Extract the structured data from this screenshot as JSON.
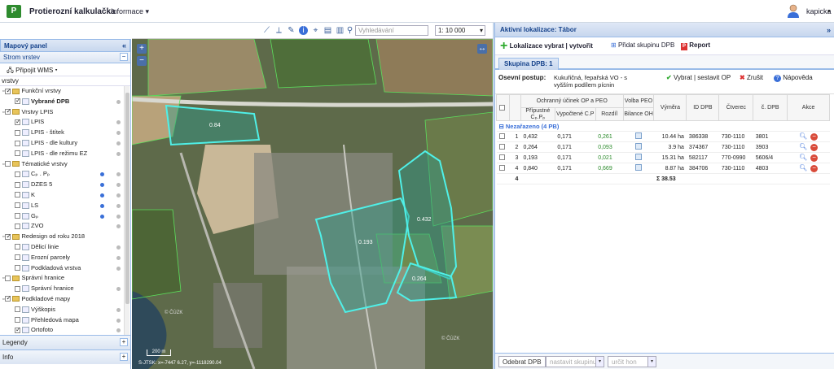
{
  "app": {
    "logo": "P",
    "title": "Protierozní kalkulačka",
    "info_menu": "Informace",
    "user": "kapicka"
  },
  "map_toolbar": {
    "search_placeholder": "Vyhledávání",
    "scale": "1: 10 000"
  },
  "map": {
    "scalebar": "200 m",
    "coords": "S-JTSK: x=-7447 6.27, y=-1118290.04",
    "watermark": "© ČÚZK",
    "labels": {
      "p1": "0.84",
      "p2": "0.193",
      "p3": "0.432",
      "p4": "0.264"
    }
  },
  "left_panel": {
    "title": "Mapový panel",
    "tree_title": "Strom vrstev",
    "wms_button": "Připojit WMS",
    "layers_label": "vrstvy",
    "tree": [
      {
        "label": "Funkční vrstvy",
        "level": 0,
        "type": "folder",
        "checked": true
      },
      {
        "label": "Vybrané DPB",
        "level": 1,
        "type": "layer",
        "checked": true,
        "bold": true,
        "dot": true
      },
      {
        "label": "Vrstvy LPIS",
        "level": 0,
        "type": "folder",
        "checked": true
      },
      {
        "label": "LPIS",
        "level": 1,
        "type": "layer",
        "checked": true,
        "dot": true
      },
      {
        "label": "LPIS - štítek",
        "level": 1,
        "type": "layer",
        "checked": false,
        "dot": true
      },
      {
        "label": "LPIS - dle kultury",
        "level": 1,
        "type": "layer",
        "checked": false,
        "dot": true
      },
      {
        "label": "LPIS - dle režimu EZ",
        "level": 1,
        "type": "layer",
        "checked": false,
        "dot": true
      },
      {
        "label": "Tématické vrstvy",
        "level": 0,
        "type": "folder",
        "checked": false
      },
      {
        "label": "Cₚ . Pₚ",
        "level": 1,
        "type": "layer",
        "checked": false,
        "dot": true,
        "info": true
      },
      {
        "label": "DZES 5",
        "level": 1,
        "type": "layer",
        "checked": false,
        "dot": true,
        "info": true
      },
      {
        "label": "K",
        "level": 1,
        "type": "layer",
        "checked": false,
        "dot": true,
        "info": true
      },
      {
        "label": "LS",
        "level": 1,
        "type": "layer",
        "checked": false,
        "dot": true,
        "info": true
      },
      {
        "label": "Gₚ",
        "level": 1,
        "type": "layer",
        "checked": false,
        "dot": true,
        "info": true
      },
      {
        "label": "ZVO",
        "level": 1,
        "type": "layer",
        "checked": false,
        "dot": true
      },
      {
        "label": "Redesign od roku 2018",
        "level": 0,
        "type": "folder",
        "checked": true
      },
      {
        "label": "Dělicí linie",
        "level": 1,
        "type": "layer",
        "checked": false,
        "dot": true
      },
      {
        "label": "Erozní parcely",
        "level": 1,
        "type": "layer",
        "checked": false,
        "dot": true
      },
      {
        "label": "Podkladová vrstva",
        "level": 1,
        "type": "layer",
        "checked": false,
        "dot": true
      },
      {
        "label": "Správní hranice",
        "level": 0,
        "type": "folder",
        "checked": false
      },
      {
        "label": "Správní hranice",
        "level": 1,
        "type": "layer",
        "checked": false,
        "dot": true
      },
      {
        "label": "Podkladové mapy",
        "level": 0,
        "type": "folder",
        "checked": true
      },
      {
        "label": "Výškopis",
        "level": 1,
        "type": "layer",
        "checked": false,
        "dot": true
      },
      {
        "label": "Přehledová mapa",
        "level": 1,
        "type": "layer",
        "checked": false,
        "dot": true
      },
      {
        "label": "Ortofoto",
        "level": 1,
        "type": "layer",
        "checked": true,
        "dot": true
      }
    ],
    "bottom_panels": [
      "Legendy",
      "Info"
    ]
  },
  "right_panel": {
    "title": "Aktivní lokalizace: Tábor",
    "toolbar": {
      "localize": "Lokalizace vybrat | vytvořit",
      "add_group": "Přidat skupinu DPB",
      "report": "Report"
    },
    "tab": "Skupina DPB: 1",
    "osev": {
      "label": "Osevní postup:",
      "value": "Kukuřičná, řepařská VO - s vyšším podílem pícnin",
      "select_button": "Vybrat | sestavit OP",
      "cancel_button": "Zrušit",
      "help_button": "Nápověda"
    },
    "table": {
      "group_header": "Ochranný účinek OP a PEO",
      "headers": {
        "permissible": "Přípustné Cₚ.Pₚ",
        "computed": "Vypočtené C.P",
        "diff": "Rozdíl",
        "peo_top": "Volba PEO",
        "peo_bottom": "Bilance OH",
        "area": "Výměra",
        "id": "ID DPB",
        "square": "Čtverec",
        "num": "č. DPB",
        "actions": "Akce"
      },
      "group_row": "Nezařazeno (4 PB)",
      "rows": [
        {
          "n": "1",
          "permissible": "0,432",
          "computed": "0,171",
          "diff": "0,261",
          "area": "10.44 ha",
          "id": "386338",
          "square": "730-1110",
          "num": "3801"
        },
        {
          "n": "2",
          "permissible": "0,264",
          "computed": "0,171",
          "diff": "0,093",
          "area": "3.9 ha",
          "id": "374367",
          "square": "730-1110",
          "num": "3903"
        },
        {
          "n": "3",
          "permissible": "0,193",
          "computed": "0,171",
          "diff": "0,021",
          "area": "15.31 ha",
          "id": "582117",
          "square": "770-0990",
          "num": "5606/4"
        },
        {
          "n": "4",
          "permissible": "0,840",
          "computed": "0,171",
          "diff": "0,669",
          "area": "8.87 ha",
          "id": "384706",
          "square": "730-1110",
          "num": "4803"
        }
      ],
      "summary": {
        "count": "4",
        "total": "Σ 38.53"
      }
    },
    "bottom": {
      "remove_button": "Odebrat DPB",
      "group_placeholder": "nastavit skupinu",
      "hon_placeholder": "určit hon"
    }
  }
}
